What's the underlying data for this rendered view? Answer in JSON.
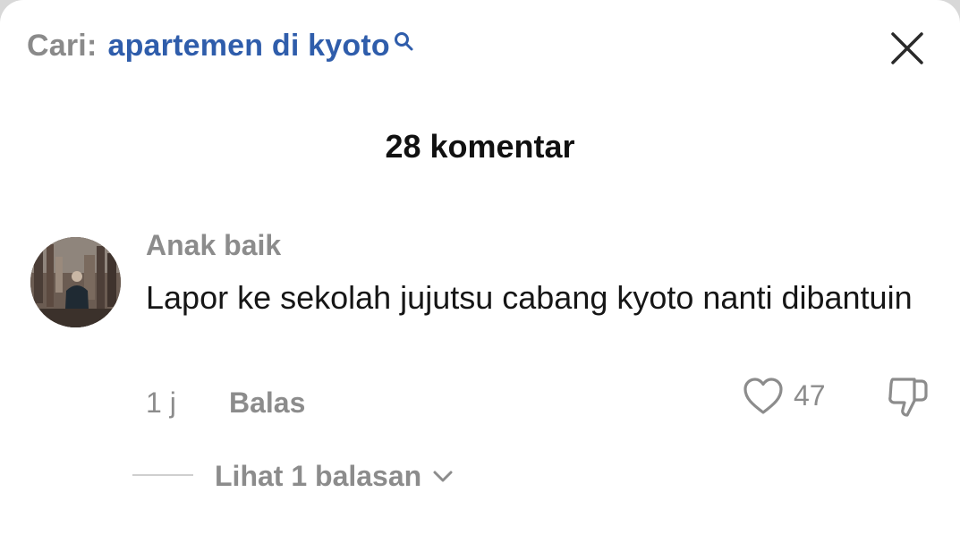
{
  "search": {
    "prefix": "Cari:",
    "query": "apartemen di kyoto"
  },
  "comments_header": {
    "title": "28 komentar"
  },
  "comment": {
    "username": "Anak baik",
    "text": "Lapor ke sekolah jujutsu cabang kyoto nanti dibantuin",
    "time": "1 j",
    "reply_label": "Balas",
    "like_count": "47",
    "view_replies_label": "Lihat 1 balasan"
  },
  "icons": {
    "search": "search-icon",
    "close": "close-icon",
    "like": "heart-icon",
    "dislike": "thumbs-down-icon",
    "expand": "chevron-down-icon"
  },
  "colors": {
    "link_blue": "#2f5dab",
    "muted_gray": "#8c8c8c",
    "text": "#161616"
  }
}
